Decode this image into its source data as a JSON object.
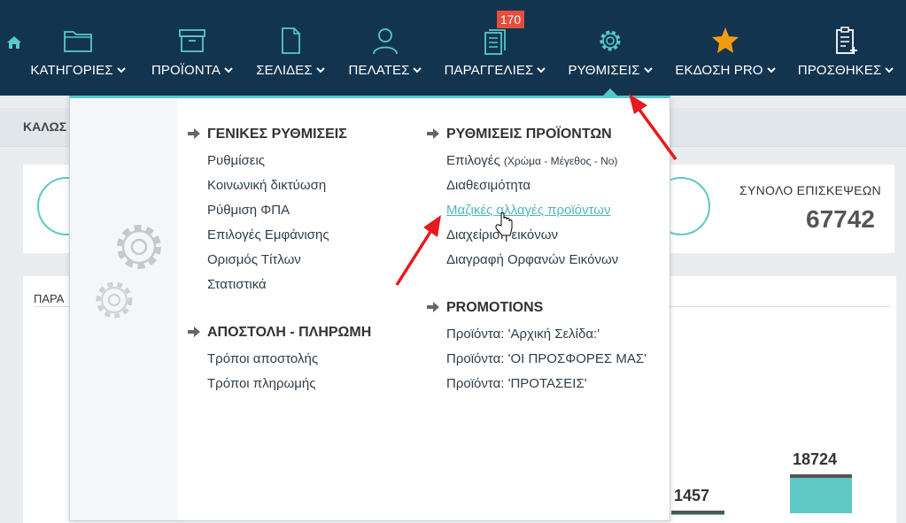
{
  "nav": {
    "badge": "170",
    "items": [
      {
        "label": "ΚΑΤΗΓΟΡΙΕΣ"
      },
      {
        "label": "ΠΡΟΪΟΝΤΑ"
      },
      {
        "label": "ΣΕΛΙΔΕΣ"
      },
      {
        "label": "ΠΕΛΑΤΕΣ"
      },
      {
        "label": "ΠΑΡΑΓΓΕΛΙΕΣ"
      },
      {
        "label": "ΡΥΘΜΙΣΕΙΣ"
      },
      {
        "label": "ΕΚΔΟΣΗ PRO"
      },
      {
        "label": "ΠΡΟΣΘΗΚΕΣ"
      }
    ]
  },
  "page": {
    "breadcrumb": "ΚΑΛΩΣ",
    "visits_label": "ΣΥΝΟΛΟ ΕΠΙΣΚΕΨΕΩΝ",
    "visits_value": "67742",
    "chart_title": "ΠΑΡΑ"
  },
  "chart_data": {
    "type": "bar",
    "values": [
      1457,
      18724
    ]
  },
  "dropdown": {
    "general": {
      "title": "ΓΕΝΙΚΕΣ ΡΥΘΜΙΣΕΙΣ",
      "links": [
        "Ρυθμίσεις",
        "Κοινωνική δικτύωση",
        "Ρύθμιση ΦΠΑ",
        "Επιλογές Εμφάνισης",
        "Ορισμός Τίτλων",
        "Στατιστικά"
      ]
    },
    "shipping": {
      "title": "ΑΠΟΣΤΟΛΗ - ΠΛΗΡΩΜΗ",
      "links": [
        "Τρόποι αποστολής",
        "Τρόποι πληρωμής"
      ]
    },
    "products": {
      "title": "ΡΥΘΜΙΣΕΙΣ ΠΡΟΪΟΝΤΩΝ",
      "options_main": "Επιλογές",
      "options_sub": "(Χρώμα - Μέγεθος - Νο)",
      "links": [
        "Διαθεσιμότητα",
        "Μαζικές αλλαγές προϊόντων",
        "Διαχείριση εικόνων",
        "Διαγραφή Ορφανών Εικόνων"
      ]
    },
    "promotions": {
      "title": "PROMOTIONS",
      "links": [
        "Προϊόντα: 'Αρχική Σελίδα:'",
        "Προϊόντα: 'ΟΙ ΠΡΟΣΦΟΡΕΣ ΜΑΣ'",
        "Προϊόντα: 'ΠΡΟΤΑΣΕΙΣ'"
      ]
    }
  },
  "colors": {
    "nav_bg": "#13344f",
    "accent": "#55cac9",
    "badge": "#e74c3c",
    "star": "#f39c12",
    "arrow": "#e8191c"
  }
}
